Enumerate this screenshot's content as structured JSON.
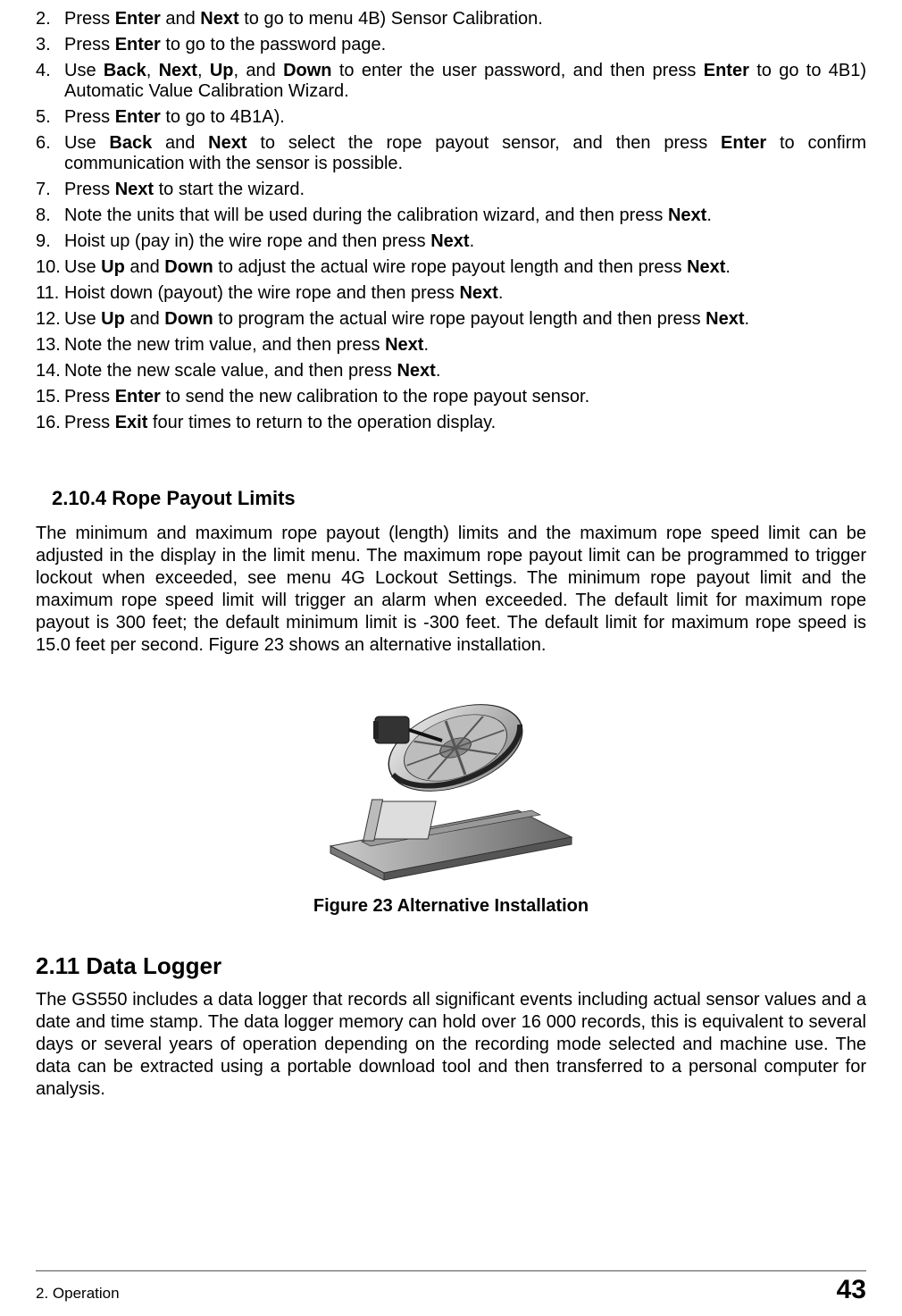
{
  "steps": {
    "n2": "2.",
    "t2_a": "Press ",
    "t2_b": "Enter",
    "t2_c": " and ",
    "t2_d": "Next",
    "t2_e": " to go to menu 4B) Sensor Calibration.",
    "n3": "3.",
    "t3_a": "Press ",
    "t3_b": "Enter",
    "t3_c": " to go to the password page.",
    "n4": "4.",
    "t4_a": "Use ",
    "t4_b": "Back",
    "t4_c": ", ",
    "t4_d": "Next",
    "t4_e": ", ",
    "t4_f": "Up",
    "t4_g": ", and ",
    "t4_h": "Down",
    "t4_i": " to enter the user password, and then press ",
    "t4_j": "Enter",
    "t4_k": " to go to 4B1) Automatic Value Calibration Wizard.",
    "n5": "5.",
    "t5_a": "Press ",
    "t5_b": "Enter",
    "t5_c": " to go to 4B1A).",
    "n6": "6.",
    "t6_a": "Use ",
    "t6_b": "Back",
    "t6_c": " and ",
    "t6_d": "Next",
    "t6_e": " to select the rope payout sensor, and then press ",
    "t6_f": "Enter",
    "t6_g": " to confirm communication with the sensor is possible.",
    "n7": "7.",
    "t7_a": "Press ",
    "t7_b": "Next",
    "t7_c": " to start the wizard.",
    "n8": "8.",
    "t8_a": "Note the units that will be used during the calibration wizard, and then press ",
    "t8_b": "Next",
    "t8_c": ".",
    "n9": "9.",
    "t9_a": "Hoist up (pay in) the wire rope and then press ",
    "t9_b": "Next",
    "t9_c": ".",
    "n10": "10.",
    "t10_a": "Use ",
    "t10_b": "Up",
    "t10_c": " and ",
    "t10_d": "Down",
    "t10_e": " to adjust the actual wire rope payout length and then press ",
    "t10_f": "Next",
    "t10_g": ".",
    "n11": "11.",
    "t11_a": "Hoist down (payout) the wire rope and then press ",
    "t11_b": "Next",
    "t11_c": ".",
    "n12": "12.",
    "t12_a": "Use ",
    "t12_b": "Up",
    "t12_c": " and ",
    "t12_d": "Down",
    "t12_e": " to program the actual wire rope payout length and then press ",
    "t12_f": "Next",
    "t12_g": ".",
    "n13": "13.",
    "t13_a": "Note the new trim value, and then press ",
    "t13_b": "Next",
    "t13_c": ".",
    "n14": "14.",
    "t14_a": "Note the new scale value, and then press ",
    "t14_b": "Next",
    "t14_c": ".",
    "n15": "15.",
    "t15_a": "Press ",
    "t15_b": "Enter",
    "t15_c": " to send the new calibration to the rope payout sensor.",
    "n16": "16.",
    "t16_a": "Press ",
    "t16_b": "Exit",
    "t16_c": " four times to return to the operation display."
  },
  "sub_heading_2_10_4": "2.10.4 Rope Payout Limits",
  "para_2_10_4": "The minimum and maximum rope payout (length) limits and the maximum rope speed limit can be adjusted in the display in the limit menu. The maximum rope payout limit can be programmed to trigger lockout when exceeded, see menu 4G Lockout Settings. The minimum rope payout limit and the maximum rope speed limit will trigger an alarm when exceeded. The default limit for maximum rope payout is 300 feet; the default minimum limit is -300 feet. The default limit for maximum rope speed is 15.0 feet per second.  Figure 23 shows an alternative installation.",
  "figure_caption": "Figure 23  Alternative Installation",
  "sec_heading_2_11": "2.11 Data Logger",
  "para_2_11": "The GS550 includes a data logger that records all significant events including actual sensor values and a date and time stamp. The data logger memory can hold over 16 000 records, this is equivalent to several days or several years of operation depending on the recording mode selected and machine use. The data can be extracted using a portable download tool and then transferred to a personal computer for analysis.",
  "footer_left": "2. Operation",
  "footer_right": "43"
}
